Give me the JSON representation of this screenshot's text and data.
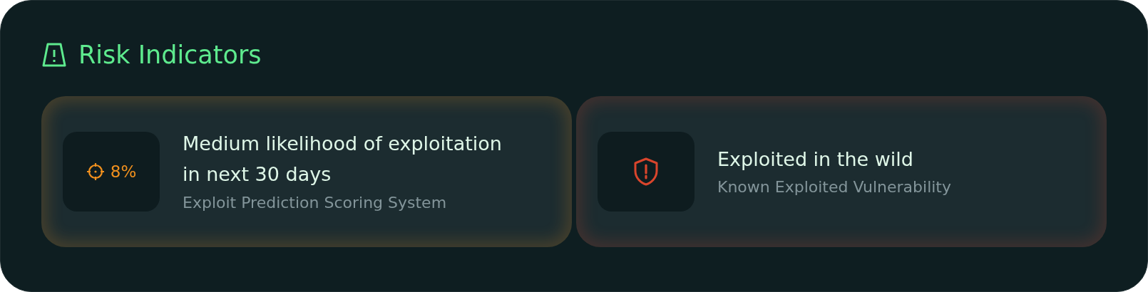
{
  "section": {
    "title": "Risk Indicators"
  },
  "indicators": [
    {
      "kind": "prediction",
      "color": "#f0901e",
      "value": "8%",
      "title": "Medium likelihood of exploitation in next 30 days",
      "subtitle": "Exploit Prediction Scoring System"
    },
    {
      "kind": "exploited",
      "color": "#d9452c",
      "title": "Exploited in the wild",
      "subtitle": "Known Exploited Vulnerability"
    }
  ]
}
